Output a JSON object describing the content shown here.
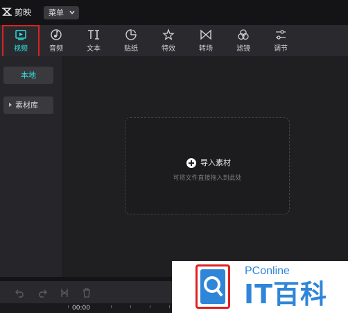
{
  "app": {
    "name": "剪映",
    "menu_label": "菜单"
  },
  "toolbar": {
    "tools": [
      {
        "label": "视频",
        "icon": "video-play-icon",
        "active": true
      },
      {
        "label": "音频",
        "icon": "music-note-icon"
      },
      {
        "label": "文本",
        "icon": "text-ti-icon"
      },
      {
        "label": "贴纸",
        "icon": "sticker-icon"
      },
      {
        "label": "特效",
        "icon": "sparkle-star-icon"
      },
      {
        "label": "转场",
        "icon": "transition-bowtie-icon"
      },
      {
        "label": "滤镜",
        "icon": "filter-circles-icon"
      },
      {
        "label": "调节",
        "icon": "sliders-icon"
      }
    ],
    "accent_color": "#2ee6e6",
    "highlight_color": "#e02020"
  },
  "sidebar": {
    "local": "本地",
    "library": "素材库"
  },
  "dropzone": {
    "import_label": "导入素材",
    "hint": "可将文件直接拖入到此处"
  },
  "timeline": {
    "tools": [
      "undo-icon",
      "redo-icon",
      "split-icon",
      "delete-icon"
    ],
    "timecode": "00:00"
  },
  "watermark": {
    "brand": "PConline",
    "text": "IT百科"
  }
}
